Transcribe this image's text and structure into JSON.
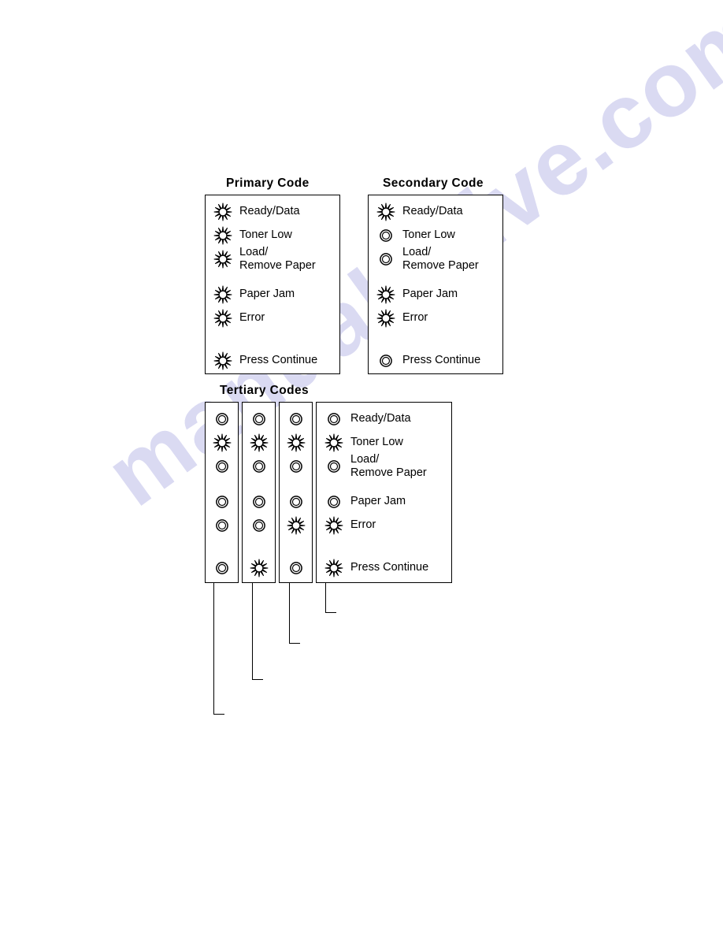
{
  "watermark": {
    "text": "manualshive.com"
  },
  "diagram": {
    "title_primary": "Primary Code",
    "title_secondary": "Secondary Code",
    "title_tertiary": "Tertiary Codes",
    "led_states": {
      "on": "lit",
      "off": "unlit"
    },
    "row_labels": [
      "Ready/Data",
      "Toner Low",
      "Load/\nRemove Paper",
      "Paper Jam",
      "Error",
      "Press Continue"
    ],
    "panels": [
      {
        "name": "primary",
        "title": "Primary Code",
        "labeled": true,
        "states": [
          "on",
          "on",
          "on",
          "on",
          "on",
          "on"
        ]
      },
      {
        "name": "secondary",
        "title": "Secondary Code",
        "labeled": true,
        "states": [
          "on",
          "off",
          "off",
          "on",
          "on",
          "off"
        ]
      }
    ],
    "tertiary": {
      "title": "Tertiary Codes",
      "columns": [
        {
          "name": "tertiary-column-1",
          "labeled": false,
          "states": [
            "off",
            "on",
            "off",
            "off",
            "off",
            "off"
          ]
        },
        {
          "name": "tertiary-column-2",
          "labeled": false,
          "states": [
            "off",
            "on",
            "off",
            "off",
            "off",
            "on"
          ]
        },
        {
          "name": "tertiary-column-3",
          "labeled": false,
          "states": [
            "off",
            "on",
            "off",
            "off",
            "on",
            "off"
          ]
        },
        {
          "name": "tertiary-column-4",
          "labeled": true,
          "states": [
            "off",
            "on",
            "off",
            "off",
            "on",
            "on"
          ]
        }
      ]
    }
  }
}
